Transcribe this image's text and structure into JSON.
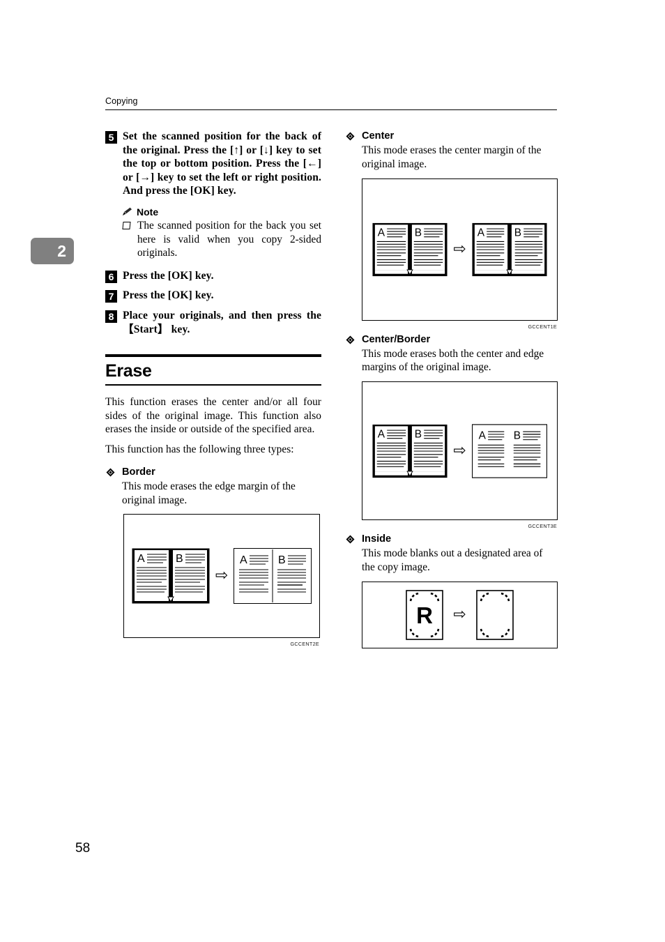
{
  "header": {
    "running_head": "Copying",
    "chapter_tab": "2",
    "page_number": "58"
  },
  "left_column": {
    "steps": [
      {
        "number": "5",
        "text": "Set the scanned position for the back of the original. Press the [↑] or [↓] key to set the top or bottom position. Press the [←] or [→] key to set the left or right position. And press the [OK] key."
      },
      {
        "number": "6",
        "text": "Press the [OK] key."
      },
      {
        "number": "7",
        "text": "Press the [OK] key."
      },
      {
        "number": "8",
        "text": "Place your originals, and then press the 【Start】 key."
      }
    ],
    "note": {
      "title": "Note",
      "icon": "pencil-icon",
      "items": [
        "The scanned position for the back you set here is valid when you copy 2-sided originals."
      ]
    },
    "section": {
      "title": "Erase",
      "paragraphs": [
        "This function erases the center and/or all four sides of the original image. This function also erases the inside or outside of the specified area.",
        "This function has the following three types:"
      ]
    },
    "border_mode": {
      "title": "Border",
      "description": "This mode erases the edge margin of the original image.",
      "figure_caption": "GCCENT2E"
    }
  },
  "right_column": {
    "center_mode": {
      "title": "Center",
      "description": "This mode erases the center margin of the original image.",
      "figure_caption": "GCCENT1E"
    },
    "center_border_mode": {
      "title": "Center/Border",
      "description": "This mode erases both the center and edge margins of the original image.",
      "figure_caption": "GCCENT3E"
    },
    "inside_mode": {
      "title": "Inside",
      "description": "This mode blanks out a designated area of the copy image.",
      "figure_caption": ""
    }
  },
  "figures": {
    "book_page_labels": [
      "A",
      "B"
    ],
    "inside_letter": "R",
    "arrow_glyph": "⇨"
  },
  "colors": {
    "text": "#000000",
    "chapter_tab_bg": "#808080",
    "chapter_tab_fg": "#ffffff",
    "rule": "#000000"
  }
}
